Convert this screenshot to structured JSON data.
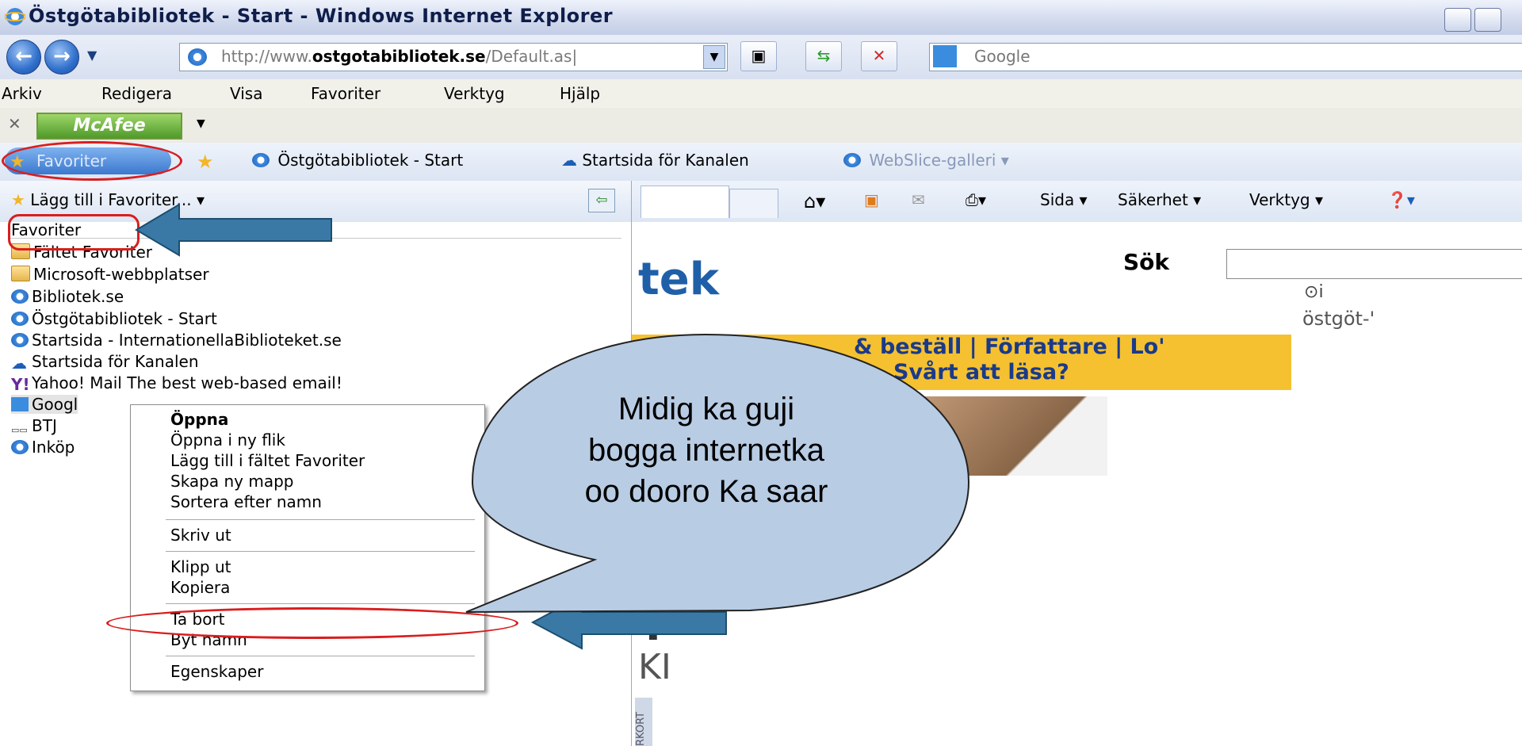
{
  "window": {
    "title": "Östgötabibliotek - Start - Windows Internet Explorer"
  },
  "address": {
    "url_prefix": "http://www.",
    "url_domain": "ostgotabibliotek.se",
    "url_rest": "/Default.as|",
    "search_placeholder": "Google"
  },
  "menu": [
    "Arkiv",
    "Redigera",
    "Visa",
    "Favoriter",
    "Verktyg",
    "Hjälp"
  ],
  "mcafee": {
    "label": "McAfee"
  },
  "favbar": {
    "favorites_button": "Favoriter",
    "items": [
      "Östgötabibliotek - Start",
      "Startsida för Kanalen",
      "WebSlice-galleri ▾"
    ]
  },
  "commandbar": {
    "page": "Sida ▾",
    "security": "Säkerhet ▾",
    "tools": "Verktyg ▾"
  },
  "pane": {
    "add_favorite": "Lägg till i Favoriter...",
    "root": "Favoriter",
    "items": [
      "Fältet Favoriter",
      "Microsoft-webbplatser",
      "Bibliotek.se",
      "Östgötabibliotek - Start",
      "Startsida - InternationellaBiblioteket.se",
      "Startsida för Kanalen",
      "Yahoo! Mail The best web-based email!",
      "Googl",
      "BTJ",
      "Inköp"
    ]
  },
  "context_menu": {
    "items": [
      "Öppna",
      "Öppna i ny flik",
      "Lägg till i fältet Favoriter",
      "Skapa ny mapp",
      "Sortera efter namn",
      "Skriv ut",
      "Klipp ut",
      "Kopiera",
      "Ta bort",
      "Byt namn",
      "Egenskaper"
    ]
  },
  "webpage": {
    "logo_fragment": "tek",
    "search_label": "Sök",
    "radio_label": "i",
    "radio_sub": "östgöt-'",
    "band_line1": "& beställ | Författare | Lo'",
    "band_line2": "Svårt att läsa?",
    "fragment1": "Y",
    "fragment2": "KI",
    "vertical_text": "RKORT"
  },
  "callout": {
    "line1": "Midig ka guji",
    "line2": "bogga internetka",
    "line3": "oo dooro Ka saar"
  },
  "colors": {
    "highlight_oval": "#d91e1e",
    "arrow_fill": "#3a79a6",
    "callout_fill": "#b8cce4"
  }
}
